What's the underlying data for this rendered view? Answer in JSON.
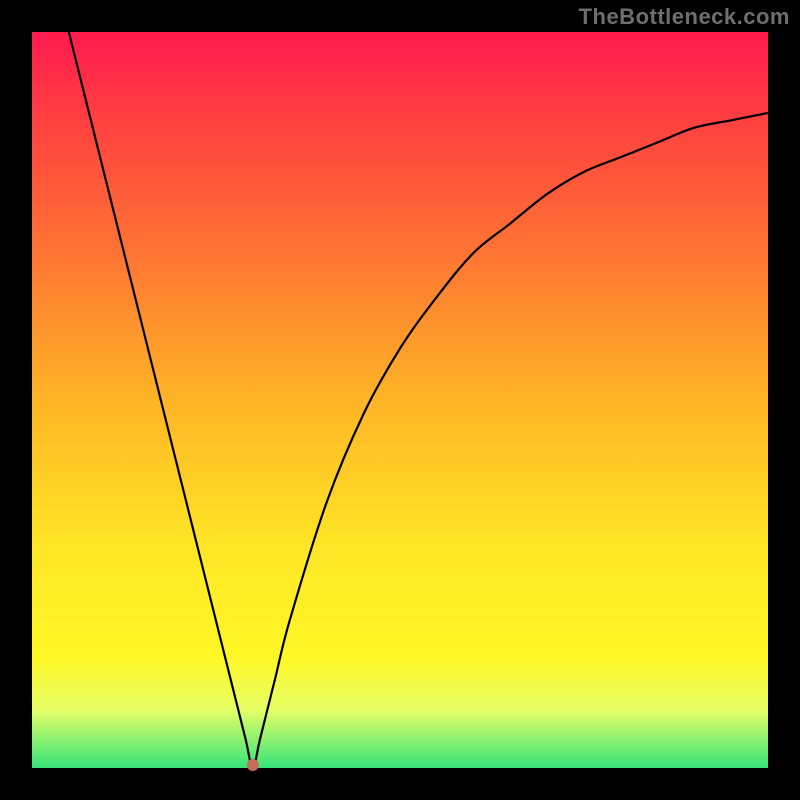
{
  "watermark": "TheBottleneck.com",
  "colors": {
    "page_bg": "#000000",
    "watermark": "#6e6e6e",
    "curve": "#000000",
    "dot": "#c76b5b",
    "gradient_stops": [
      "#ff1a4f",
      "#ff4040",
      "#ff7433",
      "#ffb426",
      "#ffe626",
      "#fff726",
      "#e8ff66",
      "#36e47a"
    ]
  },
  "chart_data": {
    "type": "line",
    "title": "",
    "xlabel": "",
    "ylabel": "",
    "xlim": [
      0,
      100
    ],
    "ylim": [
      0,
      100
    ],
    "grid": false,
    "legend": "none",
    "series": [
      {
        "name": "bottleneck-curve",
        "x": [
          5,
          10,
          15,
          20,
          25,
          27,
          29,
          30,
          31,
          33,
          35,
          40,
          45,
          50,
          55,
          60,
          65,
          70,
          75,
          80,
          85,
          90,
          95,
          100
        ],
        "y": [
          100,
          80,
          60,
          40,
          20,
          12,
          4,
          0,
          4,
          12,
          20,
          36,
          48,
          57,
          64,
          70,
          74,
          78,
          81,
          83,
          85,
          87,
          88,
          89
        ]
      }
    ],
    "annotations": [
      {
        "name": "bottleneck-point",
        "x": 30,
        "y": 0
      }
    ],
    "notes": "V-shaped curve over a vertical red→green gradient. Minimum (zero bottleneck) sits around x≈30. Left branch descends nearly linearly from top; right branch rises and asymptotes toward ~90."
  }
}
